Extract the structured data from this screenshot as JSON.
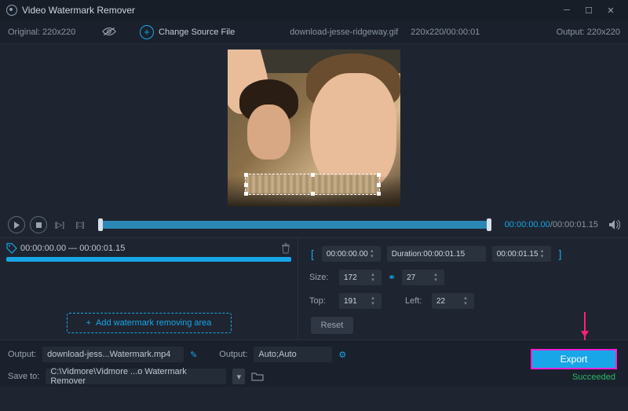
{
  "titlebar": {
    "title": "Video Watermark Remover"
  },
  "srcbar": {
    "original_label": "Original:",
    "original_dim": "220x220",
    "change_source": "Change Source File",
    "filename": "download-jesse-ridgeway.gif",
    "file_dim_time": "220x220/00:00:01",
    "output_label": "Output:",
    "output_dim": "220x220"
  },
  "playbar": {
    "time_current": "00:00:00.00",
    "time_total": "00:00:01.15"
  },
  "segment": {
    "start": "00:00:00.00",
    "end": "00:00:01.15",
    "add_label": "Add watermark removing area"
  },
  "params": {
    "range_start": "00:00:00.00",
    "duration_label": "Duration:",
    "duration_value": "00:00:01.15",
    "range_end": "00:00:01.15",
    "size_label": "Size:",
    "size_w": "172",
    "size_h": "27",
    "top_label": "Top:",
    "top_v": "191",
    "left_label": "Left:",
    "left_v": "22",
    "reset": "Reset"
  },
  "bottom": {
    "output_label": "Output:",
    "output_file": "download-jess...Watermark.mp4",
    "output2_label": "Output:",
    "output2_value": "Auto;Auto",
    "save_label": "Save to:",
    "save_path": "C:\\Vidmore\\Vidmore ...o Watermark Remover",
    "export": "Export",
    "status": "Succeeded"
  }
}
